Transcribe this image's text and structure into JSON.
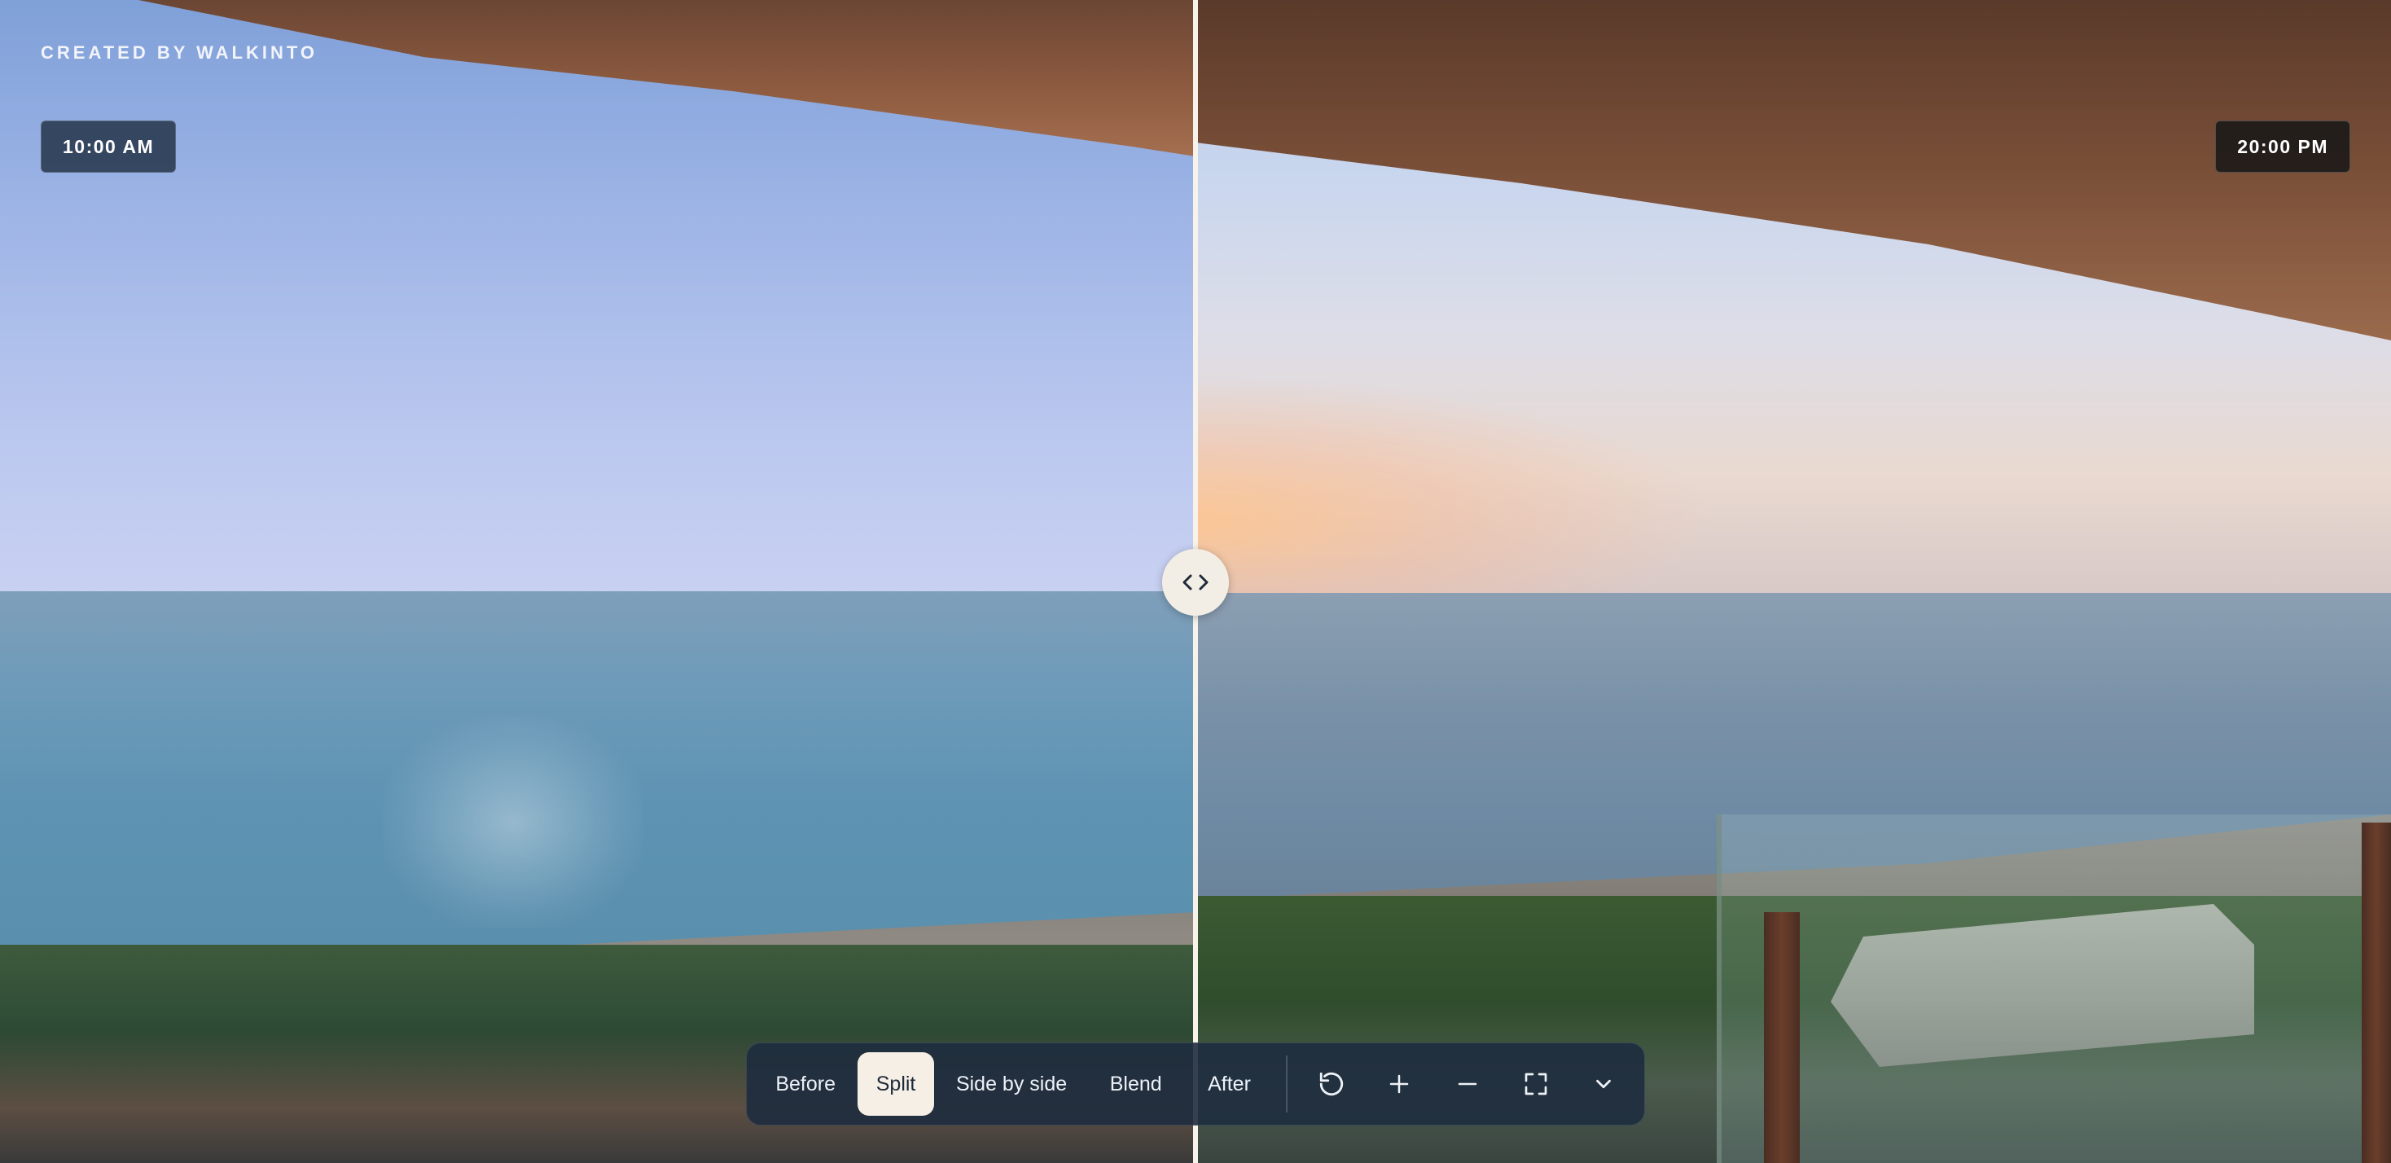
{
  "credit": "CREATED BY WALKINTO",
  "labels": {
    "before_time": "10:00 AM",
    "after_time": "20:00 PM"
  },
  "handle": {
    "icon": "chevron-left-right-icon"
  },
  "toolbar": {
    "modes": [
      {
        "label": "Before",
        "active": false
      },
      {
        "label": "Split",
        "active": true
      },
      {
        "label": "Side by side",
        "active": false
      },
      {
        "label": "Blend",
        "active": false
      },
      {
        "label": "After",
        "active": false
      }
    ],
    "icons": [
      "rotate-ccw-icon",
      "plus-icon",
      "minus-icon",
      "fullscreen-icon",
      "chevron-down-icon"
    ]
  },
  "colors": {
    "toolbar_bg": "#1e2c3e",
    "active_mode_bg": "#f5efe6",
    "divider": "#f7f2ea",
    "before_badge_bg": "#28384e",
    "after_badge_bg": "#161616"
  }
}
